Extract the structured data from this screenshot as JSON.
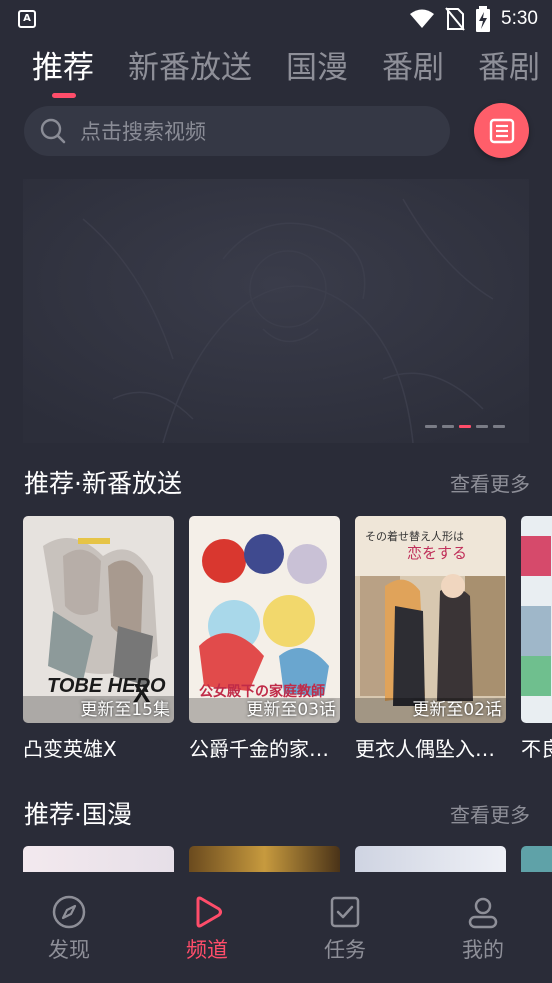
{
  "status_bar": {
    "time": "5:30",
    "app_icon": "A"
  },
  "top_tabs": [
    {
      "label": "推荐",
      "active": true
    },
    {
      "label": "新番放送",
      "active": false
    },
    {
      "label": "国漫",
      "active": false
    },
    {
      "label": "番剧",
      "active": false
    },
    {
      "label": "番剧",
      "active": false
    }
  ],
  "search": {
    "placeholder": "点击搜索视频",
    "icon": "search-icon"
  },
  "menu_button": {
    "icon": "list-icon"
  },
  "banner": {
    "dots": 5,
    "active_dot": 2
  },
  "section1": {
    "title": "推荐·新番放送",
    "more": "查看更多",
    "cards": [
      {
        "title": "凸变英雄X",
        "badge": "更新至15集"
      },
      {
        "title": "公爵千金的家…",
        "badge": "更新至03话"
      },
      {
        "title": "更衣人偶坠入…",
        "badge": "更新至02话"
      },
      {
        "title": "不良",
        "badge": ""
      }
    ]
  },
  "section2": {
    "title": "推荐·国漫",
    "more": "查看更多"
  },
  "bottom_nav": [
    {
      "label": "发现",
      "icon": "compass-icon",
      "active": false
    },
    {
      "label": "频道",
      "icon": "play-icon",
      "active": true
    },
    {
      "label": "任务",
      "icon": "task-icon",
      "active": false
    },
    {
      "label": "我的",
      "icon": "user-icon",
      "active": false
    }
  ],
  "colors": {
    "accent": "#ff4d6a",
    "background": "#2a2c38",
    "muted": "#8e8f98"
  }
}
